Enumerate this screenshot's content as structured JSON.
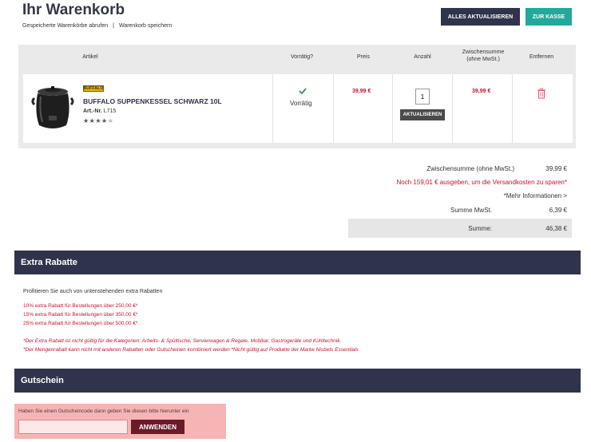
{
  "header": {
    "title": "Ihr Warenkorb",
    "link_saved": "Gespeicherte Warenkörbe abrufen",
    "link_separator": "|",
    "link_save": "Warenkorb speichern",
    "btn_update_all": "ALLES AKTUALISIEREN",
    "btn_checkout": "ZUR KASSE"
  },
  "cart": {
    "columns": {
      "artikel": "Artikel",
      "vorraetig": "Vorrätig?",
      "preis": "Preis",
      "anzahl": "Anzahl",
      "zwischensumme_1": "Zwischensumme",
      "zwischensumme_2": "(ohne MwSt.)",
      "entfernen": "Entfernen"
    },
    "items": [
      {
        "brand": "BUFFALO",
        "name": "BUFFALO SUPPENKESSEL SCHWARZ 10L",
        "art_label": "Art.-Nr.",
        "art_no": "L715",
        "rating": 4,
        "rating_max": 5,
        "stock_icon": "check-icon",
        "stock_text": "Vorrätig",
        "price": "39,99 €",
        "quantity": "1",
        "update_label": "AKTUALISIEREN",
        "subtotal": "39,99 €",
        "remove_icon": "trash-icon"
      }
    ]
  },
  "summary": {
    "subtotal_label": "Zwischensumme (ohne MwSt.)",
    "subtotal_value": "39,99 €",
    "shipping_notice": "Noch 159,01 € ausgeben, um die Versandkosten zu sparen*",
    "more_info": "*Mehr Informationen >",
    "vat_label": "Summe MwSt.",
    "vat_value": "6,39 €",
    "total_label": "Summe:",
    "total_value": "46,38 €"
  },
  "rabatt": {
    "title": "Extra Rabatte",
    "intro": "Profitieren Sie auch von untenstehenden extra Rabatten",
    "lines": [
      "10% extra Rabatt für Bestellungen über 250,00 €*",
      "15% extra Rabatt für Bestellungen über 350,00 €*",
      "25% extra Rabatt für Bestellungen über 500,00 €*"
    ],
    "notes": [
      "*Der Extra Rabatt ist nicht gültig für die Kategorien: Arbeits- & Spültische, Servierwagen & Regale, Mobiliar, Gastrogeräte und Kühltechnik.",
      "*Der Mengenrabatt kann nicht mit anderen Rabatten oder Gutscheinen kombiniert werden *Nicht gültig auf Produkte der Marke Nisbets Essentials"
    ]
  },
  "gutschein": {
    "title": "Gutschein",
    "label": "Haben Sie einen Gutscheincode dann geben Sie diesen bitte hierunter ein",
    "input_value": "",
    "btn_apply": "ANWENDEN"
  },
  "colors": {
    "navy": "#2f344c",
    "teal": "#23a99b",
    "red": "#c8102e",
    "voucher_bg": "#f6b4b4",
    "apply_btn": "#6b1a2a"
  }
}
